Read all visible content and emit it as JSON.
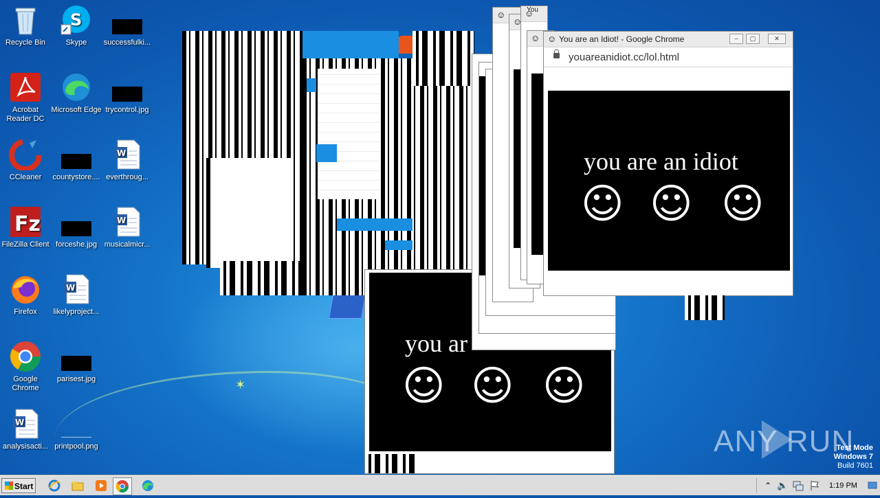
{
  "desktop_icons": [
    {
      "label": "Recycle Bin"
    },
    {
      "label": "Skype"
    },
    {
      "label": "successfulki..."
    },
    {
      "label": "Acrobat Reader DC"
    },
    {
      "label": "Microsoft Edge"
    },
    {
      "label": "trycontrol.jpg"
    },
    {
      "label": "CCleaner"
    },
    {
      "label": "countystore...."
    },
    {
      "label": "everthroug..."
    },
    {
      "label": "FileZilla Client"
    },
    {
      "label": "forceshe.jpg"
    },
    {
      "label": "musicalmicr..."
    },
    {
      "label": "Firefox"
    },
    {
      "label": "likelyproject..."
    },
    {
      "label": "Google Chrome"
    },
    {
      "label": "parisest.jpg"
    },
    {
      "label": "analysisacti..."
    },
    {
      "label": "printpool.png"
    }
  ],
  "main_window": {
    "title": "You are an Idiot! - Google Chrome",
    "url": "youareanidiot.cc/lol.html",
    "text": "you are an idiot",
    "smiley": "☺"
  },
  "lower_window": {
    "text": "you ar",
    "smiley": "☺"
  },
  "back_tab_text": "You",
  "taskbar": {
    "start_label": "Start",
    "clock": "1:19 PM"
  },
  "watermark": {
    "line1": "Test Mode",
    "line2": "Windows 7",
    "line3": "Build 7601",
    "brand": "ANY RUN"
  }
}
